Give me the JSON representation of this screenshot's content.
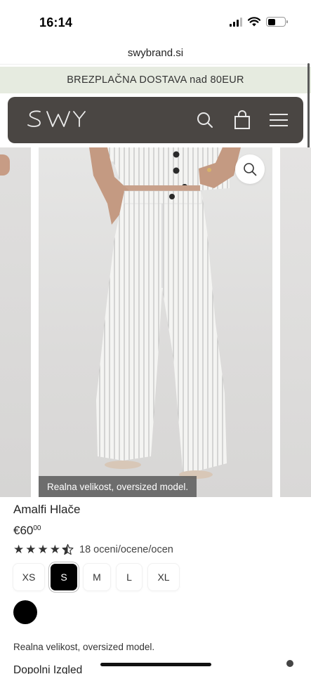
{
  "status_bar": {
    "time": "16:14"
  },
  "browser": {
    "url": "swybrand.si"
  },
  "promo": {
    "text": "BREZPLAČNA DOSTAVA nad 80EUR"
  },
  "header": {
    "logo": "SWY",
    "icons": [
      "search-icon",
      "bag-icon",
      "menu-icon"
    ],
    "background": "#4a4643"
  },
  "gallery": {
    "caption": "Realna velikost, oversized model."
  },
  "product": {
    "title": "Amalfi Hlače",
    "price_main": "€60",
    "price_cents": "00",
    "rating": 4.5,
    "rating_count_text": "18 oceni/ocene/ocen",
    "sizes": [
      "XS",
      "S",
      "M",
      "L",
      "XL"
    ],
    "selected_size": "S",
    "color": "#000000",
    "description": "Realna velikost, oversized model.",
    "more_heading": "Dopolni Izgled"
  }
}
